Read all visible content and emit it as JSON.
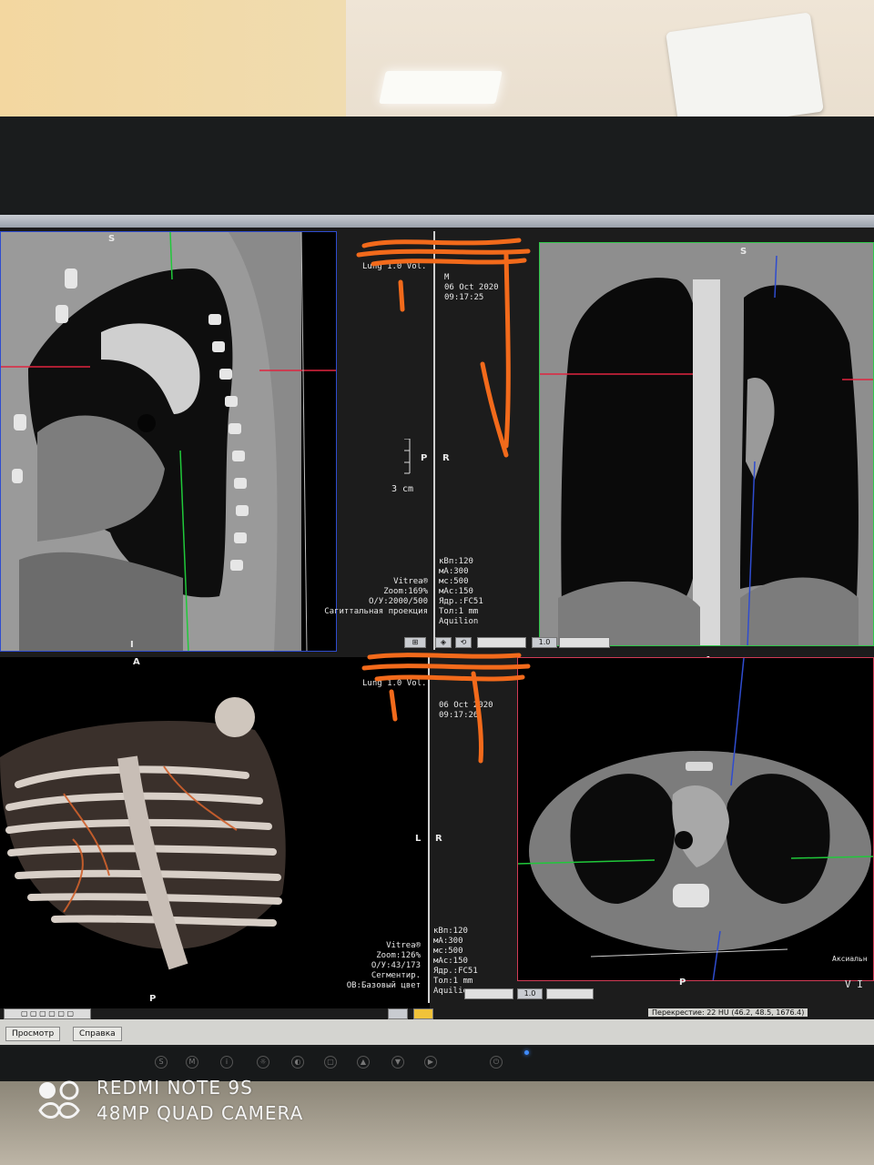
{
  "viewer": {
    "product": "Vitrea®",
    "preset": "Lung 1.0",
    "vol_label": "Vol.",
    "sex": "M",
    "date": "06 Oct 2020",
    "time": "09:17:25",
    "time_3d": "09:17:26"
  },
  "sagittal": {
    "top_label": "S",
    "bottom_label": "I",
    "zoom": "Zoom:169%",
    "window": "О/У:2000/500",
    "projection": "Сагиттальная проекция",
    "scale": "3 cm",
    "orient_p": "P",
    "orient_r": "R"
  },
  "coronal": {
    "top_label": "S",
    "bottom_label": "A",
    "params": [
      "кВп:120",
      "мА:300",
      "мс:500",
      "мАс:150",
      "Ядр.:FC51",
      "Тол:1 mm",
      "Aquilion"
    ],
    "spin_value": "1.0"
  },
  "render3d": {
    "top_label": "A",
    "bottom_label": "P",
    "orient_l": "L",
    "orient_r": "R",
    "zoom": "Zoom:126%",
    "window": "О/У:43/173",
    "segment": "Сегментир.",
    "ob": "ОВ:Базовый цвет"
  },
  "axial": {
    "bottom_label": "P",
    "side_label": "Аксиальн",
    "params": [
      "кВп:120",
      "мА:300",
      "мс:500",
      "мАс:150",
      "Ядр.:FC51",
      "Тол:1 mm",
      "Aquilion"
    ],
    "spin_value": "1.0",
    "corner": "V I"
  },
  "bottom_tabs": [
    "Просмотр",
    "Справка"
  ],
  "status_text": "Перекрестие: 22 HU (46.2, 48.5, 1676.4)",
  "watermark": {
    "line1": "REDMI NOTE 9S",
    "line2": "48MP QUAD CAMERA"
  },
  "monitor_buttons": [
    "S",
    "M",
    "i",
    "☼",
    "◐",
    "▢",
    "▲",
    "▼",
    "▶",
    "⏻"
  ],
  "colors": {
    "sag_border": "#2f4ccf",
    "cor_border": "#2fc84a",
    "ax_border": "#d23b55",
    "scribble": "#f26a1b"
  }
}
